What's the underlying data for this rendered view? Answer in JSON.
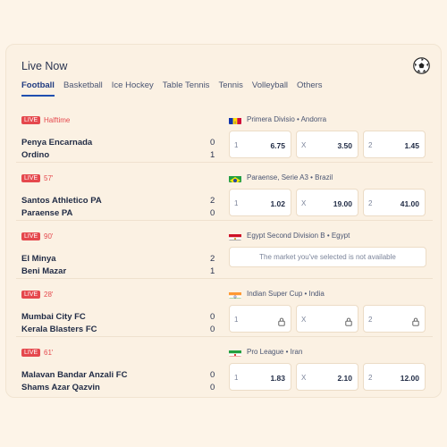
{
  "header": {
    "title": "Live Now"
  },
  "tabs": [
    "Football",
    "Basketball",
    "Ice Hockey",
    "Table Tennis",
    "Tennis",
    "Volleyball",
    "Others"
  ],
  "active_tab": "Football",
  "live_label": "LIVE",
  "unavailable_text": "The market you've selected is not available",
  "matches": [
    {
      "time": "Halftime",
      "team1": "Penya Encarnada",
      "team2": "Ordino",
      "score1": "0",
      "score2": "1",
      "league": "Primera Divisio • Andorra",
      "flag": "andorra",
      "odds": [
        {
          "label": "1",
          "value": "6.75"
        },
        {
          "label": "X",
          "value": "3.50"
        },
        {
          "label": "2",
          "value": "1.45"
        }
      ]
    },
    {
      "time": "57'",
      "team1": "Santos Athletico PA",
      "team2": "Paraense PA",
      "score1": "2",
      "score2": "0",
      "league": "Paraense, Serie A3 • Brazil",
      "flag": "brazil",
      "odds": [
        {
          "label": "1",
          "value": "1.02"
        },
        {
          "label": "X",
          "value": "19.00"
        },
        {
          "label": "2",
          "value": "41.00"
        }
      ]
    },
    {
      "time": "90'",
      "team1": "El Minya",
      "team2": "Beni Mazar",
      "score1": "2",
      "score2": "1",
      "league": "Egypt Second Division B • Egypt",
      "flag": "egypt",
      "unavailable": true
    },
    {
      "time": "28'",
      "team1": "Mumbai City FC",
      "team2": "Kerala Blasters FC",
      "score1": "0",
      "score2": "0",
      "league": "Indian Super Cup • India",
      "flag": "india",
      "odds": [
        {
          "label": "1",
          "locked": true
        },
        {
          "label": "X",
          "locked": true
        },
        {
          "label": "2",
          "locked": true
        }
      ]
    },
    {
      "time": "61'",
      "team1": "Malavan Bandar Anzali FC",
      "team2": "Shams Azar Qazvin",
      "score1": "0",
      "score2": "0",
      "league": "Pro League • Iran",
      "flag": "iran",
      "odds": [
        {
          "label": "1",
          "value": "1.83"
        },
        {
          "label": "X",
          "value": "2.10"
        },
        {
          "label": "2",
          "value": "12.00"
        }
      ]
    }
  ],
  "colors": {
    "live": "#e5484d",
    "accent": "#1f4fb0",
    "background": "#fdf4e8"
  }
}
